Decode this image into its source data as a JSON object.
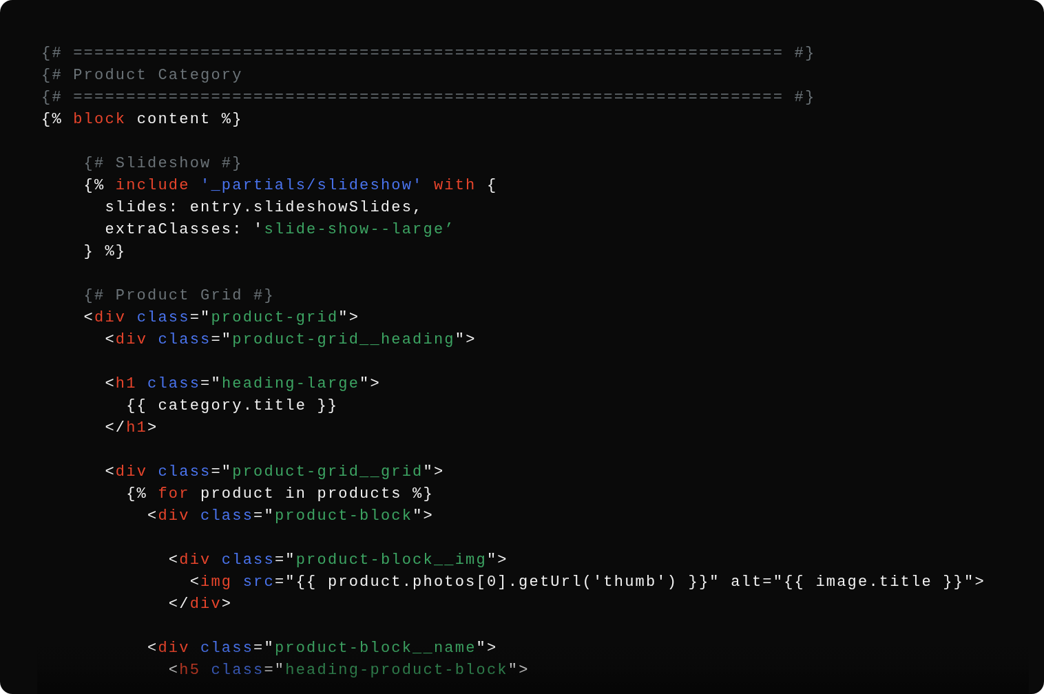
{
  "code_lines": [
    {
      "kind": "code",
      "tokens": [
        {
          "kind": "comment",
          "text": "{# =================================================================== #}"
        }
      ]
    },
    {
      "kind": "code",
      "tokens": [
        {
          "kind": "comment",
          "text": "{# Product Category"
        }
      ]
    },
    {
      "kind": "code",
      "tokens": [
        {
          "kind": "comment",
          "text": "{# =================================================================== #}"
        }
      ]
    },
    {
      "kind": "code",
      "tokens": [
        {
          "kind": "plain",
          "text": "{% "
        },
        {
          "kind": "keyword",
          "text": "block"
        },
        {
          "kind": "plain",
          "text": " content %}"
        }
      ]
    },
    {
      "kind": "blank"
    },
    {
      "kind": "code",
      "tokens": [
        {
          "kind": "comment",
          "text": "    {# Slideshow #}"
        }
      ]
    },
    {
      "kind": "code",
      "tokens": [
        {
          "kind": "plain",
          "text": "    {% "
        },
        {
          "kind": "keyword",
          "text": "include"
        },
        {
          "kind": "attr",
          "text": " '_partials/slideshow'"
        },
        {
          "kind": "keyword",
          "text": " with"
        },
        {
          "kind": "plain",
          "text": " {"
        }
      ]
    },
    {
      "kind": "code",
      "tokens": [
        {
          "kind": "plain",
          "text": "      slides: entry.slideshowSlides,"
        }
      ]
    },
    {
      "kind": "code",
      "tokens": [
        {
          "kind": "plain",
          "text": "      extraClasses: '"
        },
        {
          "kind": "string",
          "text": "slide-show--large’"
        }
      ]
    },
    {
      "kind": "code",
      "tokens": [
        {
          "kind": "plain",
          "text": "    } %}"
        }
      ]
    },
    {
      "kind": "blank"
    },
    {
      "kind": "code",
      "tokens": [
        {
          "kind": "comment",
          "text": "    {# Product Grid #}"
        }
      ]
    },
    {
      "kind": "code",
      "tokens": [
        {
          "kind": "plain",
          "text": "    <"
        },
        {
          "kind": "keyword",
          "text": "div"
        },
        {
          "kind": "attr",
          "text": " class"
        },
        {
          "kind": "plain",
          "text": "=\""
        },
        {
          "kind": "string",
          "text": "product-grid"
        },
        {
          "kind": "plain",
          "text": "\">"
        }
      ]
    },
    {
      "kind": "code",
      "tokens": [
        {
          "kind": "plain",
          "text": "      <"
        },
        {
          "kind": "keyword",
          "text": "div"
        },
        {
          "kind": "attr",
          "text": " class"
        },
        {
          "kind": "plain",
          "text": "=\""
        },
        {
          "kind": "string",
          "text": "product-grid__heading"
        },
        {
          "kind": "plain",
          "text": "\">"
        }
      ]
    },
    {
      "kind": "blank"
    },
    {
      "kind": "code",
      "tokens": [
        {
          "kind": "plain",
          "text": "      <"
        },
        {
          "kind": "keyword",
          "text": "h1"
        },
        {
          "kind": "attr",
          "text": " class"
        },
        {
          "kind": "plain",
          "text": "=\""
        },
        {
          "kind": "string",
          "text": "heading-large"
        },
        {
          "kind": "plain",
          "text": "\">"
        }
      ]
    },
    {
      "kind": "code",
      "tokens": [
        {
          "kind": "plain",
          "text": "        {{ category.title }}"
        }
      ]
    },
    {
      "kind": "code",
      "tokens": [
        {
          "kind": "plain",
          "text": "      </"
        },
        {
          "kind": "keyword",
          "text": "h1"
        },
        {
          "kind": "plain",
          "text": ">"
        }
      ]
    },
    {
      "kind": "blank"
    },
    {
      "kind": "code",
      "tokens": [
        {
          "kind": "plain",
          "text": "      <"
        },
        {
          "kind": "keyword",
          "text": "div"
        },
        {
          "kind": "attr",
          "text": " class"
        },
        {
          "kind": "plain",
          "text": "=\""
        },
        {
          "kind": "string",
          "text": "product-grid__grid"
        },
        {
          "kind": "plain",
          "text": "\">"
        }
      ]
    },
    {
      "kind": "code",
      "tokens": [
        {
          "kind": "plain",
          "text": "        {% "
        },
        {
          "kind": "keyword",
          "text": "for"
        },
        {
          "kind": "plain",
          "text": " product in products %}"
        }
      ]
    },
    {
      "kind": "code",
      "tokens": [
        {
          "kind": "plain",
          "text": "          <"
        },
        {
          "kind": "keyword",
          "text": "div"
        },
        {
          "kind": "attr",
          "text": " class"
        },
        {
          "kind": "plain",
          "text": "=\""
        },
        {
          "kind": "string",
          "text": "product-block"
        },
        {
          "kind": "plain",
          "text": "\">"
        }
      ]
    },
    {
      "kind": "blank"
    },
    {
      "kind": "code",
      "tokens": [
        {
          "kind": "plain",
          "text": "            <"
        },
        {
          "kind": "keyword",
          "text": "div"
        },
        {
          "kind": "attr",
          "text": " class"
        },
        {
          "kind": "plain",
          "text": "=\""
        },
        {
          "kind": "string",
          "text": "product-block__img"
        },
        {
          "kind": "plain",
          "text": "\">"
        }
      ]
    },
    {
      "kind": "code",
      "tokens": [
        {
          "kind": "plain",
          "text": "              <"
        },
        {
          "kind": "keyword",
          "text": "img"
        },
        {
          "kind": "attr",
          "text": " src"
        },
        {
          "kind": "plain",
          "text": "=\"{{ product.photos[0].getUrl('thumb') }}\" alt=\"{{ image.title }}\">"
        }
      ]
    },
    {
      "kind": "code",
      "tokens": [
        {
          "kind": "plain",
          "text": "            </"
        },
        {
          "kind": "keyword",
          "text": "div"
        },
        {
          "kind": "plain",
          "text": ">"
        }
      ]
    },
    {
      "kind": "blank"
    },
    {
      "kind": "code",
      "tokens": [
        {
          "kind": "plain",
          "text": "          <"
        },
        {
          "kind": "keyword",
          "text": "div"
        },
        {
          "kind": "attr",
          "text": " class"
        },
        {
          "kind": "plain",
          "text": "=\""
        },
        {
          "kind": "string",
          "text": "product-block__name"
        },
        {
          "kind": "plain",
          "text": "\">"
        }
      ]
    },
    {
      "kind": "code",
      "tokens": [
        {
          "kind": "plain",
          "text": "            <"
        },
        {
          "kind": "keyword",
          "text": "h5"
        },
        {
          "kind": "attr",
          "text": " class"
        },
        {
          "kind": "plain",
          "text": "=\""
        },
        {
          "kind": "string",
          "text": "heading-product-block"
        },
        {
          "kind": "plain",
          "text": "\">"
        }
      ]
    }
  ]
}
